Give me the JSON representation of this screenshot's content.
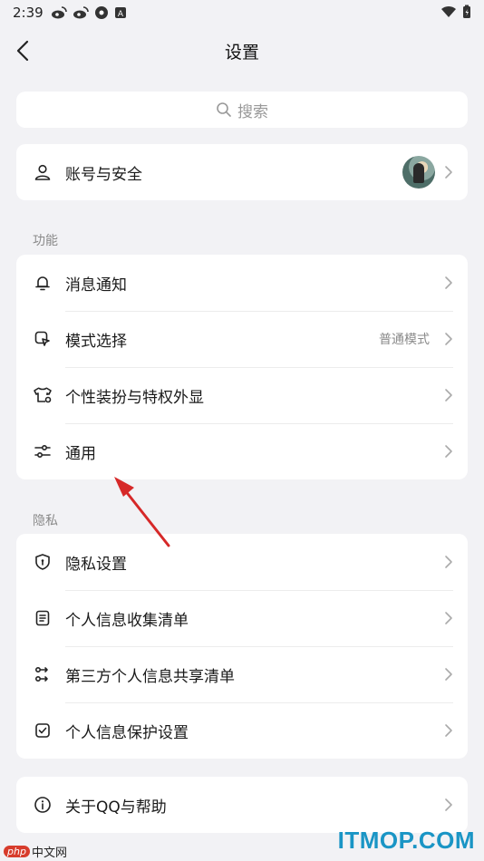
{
  "status_bar": {
    "time": "2:39"
  },
  "nav": {
    "title": "设置"
  },
  "search": {
    "placeholder": "搜索"
  },
  "account": {
    "label": "账号与安全"
  },
  "sections": {
    "features": {
      "header": "功能",
      "items": [
        {
          "label": "消息通知",
          "value": ""
        },
        {
          "label": "模式选择",
          "value": "普通模式"
        },
        {
          "label": "个性装扮与特权外显",
          "value": ""
        },
        {
          "label": "通用",
          "value": ""
        }
      ]
    },
    "privacy": {
      "header": "隐私",
      "items": [
        {
          "label": "隐私设置"
        },
        {
          "label": "个人信息收集清单"
        },
        {
          "label": "第三方个人信息共享清单"
        },
        {
          "label": "个人信息保护设置"
        }
      ]
    }
  },
  "about": {
    "label": "关于QQ与帮助"
  },
  "watermarks": {
    "itmop": "ITMOP.COM",
    "php": "php",
    "cn": "中文网"
  },
  "colors": {
    "background": "#f2f2f5",
    "card": "#ffffff",
    "annotation_arrow": "#d62828",
    "watermark": "#1a95c5"
  }
}
